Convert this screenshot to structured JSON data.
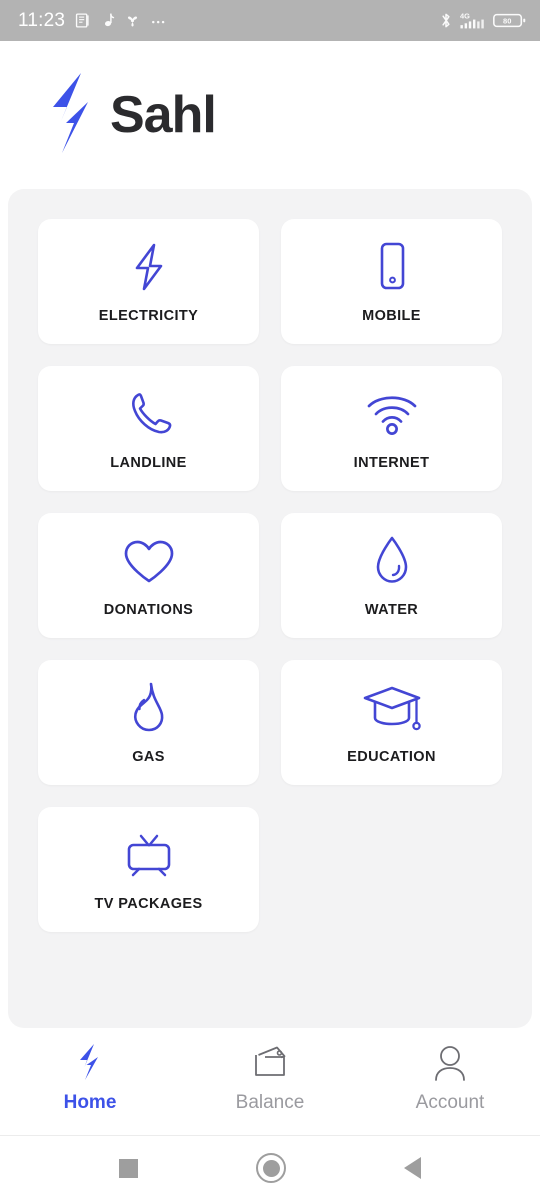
{
  "status_bar": {
    "time": "11:23",
    "left_icons": [
      "book-reader-icon",
      "music-note-icon",
      "pinwheel-icon",
      "more-dots-icon"
    ],
    "right_icons": [
      "bluetooth-icon",
      "signal-4g-icon",
      "battery-icon"
    ],
    "network_label": "4G",
    "battery_level": "80"
  },
  "header": {
    "brand_name": "Sahl",
    "logo_icon": "lightning-bolt-logo"
  },
  "services": {
    "tiles": [
      {
        "label": "ELECTRICITY",
        "icon": "lightning-bolt-icon"
      },
      {
        "label": "MOBILE",
        "icon": "smartphone-icon"
      },
      {
        "label": "LANDLINE",
        "icon": "telephone-handset-icon"
      },
      {
        "label": "INTERNET",
        "icon": "wifi-icon"
      },
      {
        "label": "DONATIONS",
        "icon": "heart-icon"
      },
      {
        "label": "WATER",
        "icon": "water-drop-icon"
      },
      {
        "label": "GAS",
        "icon": "flame-icon"
      },
      {
        "label": "EDUCATION",
        "icon": "graduation-cap-icon"
      },
      {
        "label": "TV PACKAGES",
        "icon": "television-icon"
      }
    ]
  },
  "tab_bar": {
    "tabs": [
      {
        "label": "Home",
        "icon": "lightning-bolt-icon",
        "active": true
      },
      {
        "label": "Balance",
        "icon": "wallet-icon",
        "active": false
      },
      {
        "label": "Account",
        "icon": "person-icon",
        "active": false
      }
    ]
  },
  "android_nav": {
    "buttons": [
      {
        "name": "recents-button",
        "icon": "square-icon"
      },
      {
        "name": "home-button",
        "icon": "circle-icon"
      },
      {
        "name": "back-button",
        "icon": "triangle-left-icon"
      }
    ]
  },
  "colors": {
    "accent": "#3d52e8",
    "icon_blue": "#4346d4",
    "panel_bg": "#f3f3f4",
    "tile_bg": "#ffffff",
    "status_bar_bg": "#b3b3b3",
    "label_text": "#1c1c1e",
    "inactive_tab": "#9a9a9f"
  }
}
